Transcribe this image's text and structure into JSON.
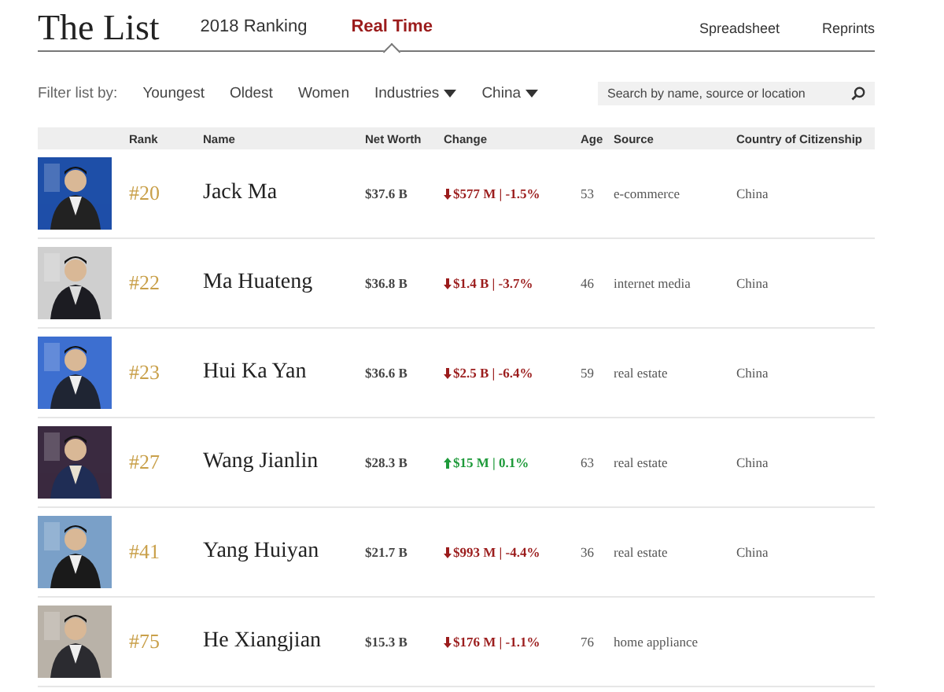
{
  "header": {
    "title": "The List",
    "tabs": [
      {
        "label": "2018 Ranking",
        "selected": false
      },
      {
        "label": "Real Time",
        "selected": true
      }
    ],
    "links": [
      "Spreadsheet",
      "Reprints"
    ]
  },
  "filters": {
    "label": "Filter list by:",
    "options": [
      {
        "label": "Youngest",
        "dropdown": false
      },
      {
        "label": "Oldest",
        "dropdown": false
      },
      {
        "label": "Women",
        "dropdown": false
      },
      {
        "label": "Industries",
        "dropdown": true
      },
      {
        "label": "China",
        "dropdown": true
      }
    ],
    "search": {
      "placeholder": "Search by name, source or location"
    }
  },
  "table": {
    "columns": [
      "Rank",
      "Name",
      "Net Worth",
      "Change",
      "Age",
      "Source",
      "Country of Citizenship"
    ],
    "rows": [
      {
        "rank": "#20",
        "name": "Jack Ma",
        "net_worth": "$37.6 B",
        "change": "$577 M | -1.5%",
        "rising": false,
        "age": "53",
        "source": "e-commerce",
        "country": "China"
      },
      {
        "rank": "#22",
        "name": "Ma Huateng",
        "net_worth": "$36.8 B",
        "change": "$1.4 B | -3.7%",
        "rising": false,
        "age": "46",
        "source": "internet media",
        "country": "China"
      },
      {
        "rank": "#23",
        "name": "Hui Ka Yan",
        "net_worth": "$36.6 B",
        "change": "$2.5 B | -6.4%",
        "rising": false,
        "age": "59",
        "source": "real estate",
        "country": "China"
      },
      {
        "rank": "#27",
        "name": "Wang Jianlin",
        "net_worth": "$28.3 B",
        "change": "$15 M | 0.1%",
        "rising": true,
        "age": "63",
        "source": "real estate",
        "country": "China"
      },
      {
        "rank": "#41",
        "name": "Yang Huiyan",
        "net_worth": "$21.7 B",
        "change": "$993 M | -4.4%",
        "rising": false,
        "age": "36",
        "source": "real estate",
        "country": "China"
      },
      {
        "rank": "#75",
        "name": "He Xiangjian",
        "net_worth": "$15.3 B",
        "change": "$176 M | -1.1%",
        "rising": false,
        "age": "76",
        "source": "home appliance"
      }
    ]
  }
}
